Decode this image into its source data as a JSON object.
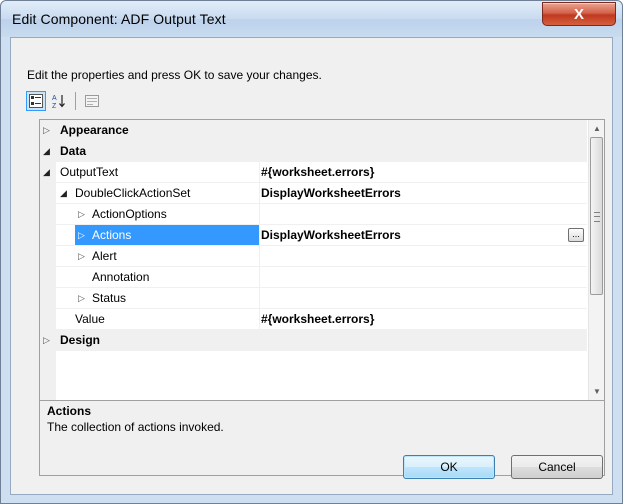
{
  "window": {
    "title": "Edit Component: ADF Output Text",
    "close_label": "X"
  },
  "instruction": "Edit the properties and press OK to save your changes.",
  "toolbar": {
    "buttons": [
      {
        "name": "categorized-view",
        "icon": "categorized-icon",
        "active": true
      },
      {
        "name": "alphabetical-sort",
        "icon": "az-sort-icon",
        "active": false
      },
      {
        "name": "property-pages",
        "icon": "property-pages-icon",
        "active": false
      }
    ]
  },
  "properties": {
    "rows": [
      {
        "label": "Appearance",
        "value": "",
        "kind": "category",
        "expander": "collapsed"
      },
      {
        "label": "Data",
        "value": "",
        "kind": "category",
        "expander": "expanded"
      },
      {
        "label": "OutputText",
        "value": "#{worksheet.errors}",
        "kind": "property",
        "expander": "expanded"
      },
      {
        "label": "DoubleClickActionSet",
        "value": "DisplayWorksheetErrors",
        "kind": "property",
        "expander": "expanded"
      },
      {
        "label": "ActionOptions",
        "value": "",
        "kind": "property",
        "expander": "collapsed"
      },
      {
        "label": "Actions",
        "value": "DisplayWorksheetErrors",
        "kind": "property",
        "expander": "collapsed",
        "selected": true,
        "has_ellipsis": true
      },
      {
        "label": "Alert",
        "value": "",
        "kind": "property",
        "expander": "collapsed"
      },
      {
        "label": "Annotation",
        "value": "",
        "kind": "property",
        "expander": "none"
      },
      {
        "label": "Status",
        "value": "",
        "kind": "property",
        "expander": "collapsed"
      },
      {
        "label": "Value",
        "value": "#{worksheet.errors}",
        "kind": "property",
        "expander": "none"
      },
      {
        "label": "Design",
        "value": "",
        "kind": "category",
        "expander": "collapsed"
      }
    ],
    "ellipsis_label": "..."
  },
  "help": {
    "title": "Actions",
    "description": "The collection of actions invoked."
  },
  "buttons": {
    "ok": "OK",
    "cancel": "Cancel"
  },
  "colors": {
    "selection": "#3399ff",
    "category_background": "#f0f0f0",
    "close_button": "#c0391f"
  }
}
